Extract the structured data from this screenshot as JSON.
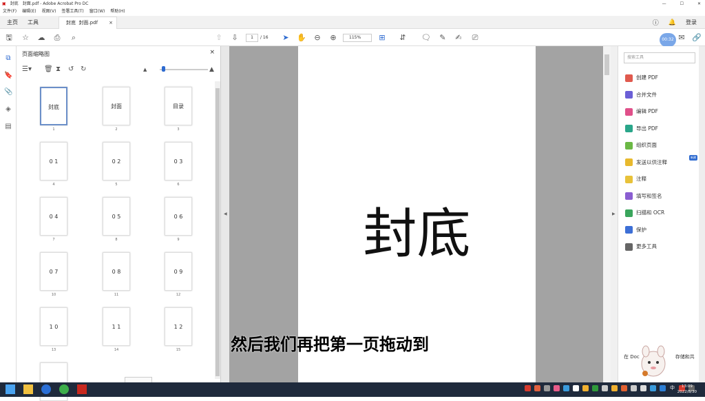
{
  "titlebar": {
    "doc_icon_text": "封底",
    "title": "封面.pdf - Adobe Acrobat Pro DC",
    "minimize": "—",
    "maximize": "☐",
    "close": "✕"
  },
  "menubar": [
    "文件(F)",
    "编辑(E)",
    "视图(V)",
    "签署工具(T)",
    "窗口(W)",
    "帮助(H)"
  ],
  "tabs": {
    "home": "主页",
    "tools": "工具",
    "doc_tab_1": "封底",
    "doc_tab_2": "封面.pdf",
    "close": "×",
    "login": "登录"
  },
  "toolbar": {
    "page_current": "1",
    "page_total": "/ 16",
    "zoom": "115%",
    "timer": "00:32"
  },
  "thumbnail_panel": {
    "title": "页面缩略图",
    "close": "×",
    "thumbs": [
      {
        "label": "封底",
        "num": "1"
      },
      {
        "label": "封面",
        "num": "2"
      },
      {
        "label": "目录",
        "num": "3"
      },
      {
        "label": "0 1",
        "num": "4"
      },
      {
        "label": "0 2",
        "num": "5"
      },
      {
        "label": "0 3",
        "num": "6"
      },
      {
        "label": "0 4",
        "num": "7"
      },
      {
        "label": "0 5",
        "num": "8"
      },
      {
        "label": "0 6",
        "num": "9"
      },
      {
        "label": "0 7",
        "num": "10"
      },
      {
        "label": "0 8",
        "num": "11"
      },
      {
        "label": "0 9",
        "num": "12"
      },
      {
        "label": "1 0",
        "num": "13"
      },
      {
        "label": "1 1",
        "num": "14"
      },
      {
        "label": "1 2",
        "num": "15"
      },
      {
        "label": "",
        "num": ""
      }
    ]
  },
  "page_content": "封底",
  "right_panel": {
    "search_placeholder": "搜索工具",
    "tools": [
      {
        "label": "创建 PDF",
        "color": "#e05a4e"
      },
      {
        "label": "合并文件",
        "color": "#6b5fd6"
      },
      {
        "label": "编辑 PDF",
        "color": "#e0508a"
      },
      {
        "label": "导出 PDF",
        "color": "#2aa68a"
      },
      {
        "label": "组织页面",
        "color": "#6bb845"
      },
      {
        "label": "发送以供注释",
        "color": "#e8b92e"
      },
      {
        "label": "注释",
        "color": "#e8c23a"
      },
      {
        "label": "填写和签名",
        "color": "#8a5ed1"
      },
      {
        "label": "扫描和 OCR",
        "color": "#3aa55c"
      },
      {
        "label": "保护",
        "color": "#3d6fd6"
      },
      {
        "label": "更多工具",
        "color": "#666666"
      }
    ],
    "new_badge": "新建",
    "share_text_left": "在 Doc",
    "share_text_right": "存储和共"
  },
  "subtitle": "然后我们再把第一页拖动到",
  "taskbar": {
    "time": "13:09",
    "date": "2022/8/30",
    "ime": "中"
  }
}
